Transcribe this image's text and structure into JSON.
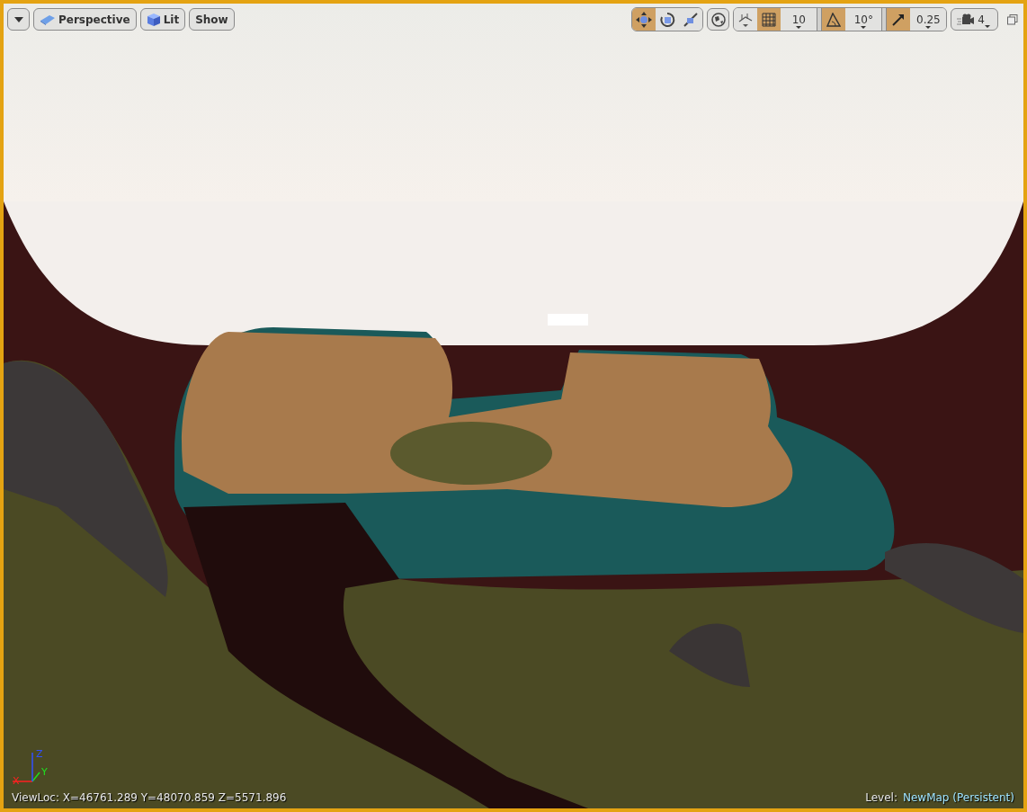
{
  "viewport": {
    "active": true
  },
  "left_buttons": [
    {
      "kind": "dropdown"
    },
    {
      "kind": "perspective",
      "label": "Perspective"
    },
    {
      "kind": "lit",
      "label": "Lit"
    },
    {
      "kind": "show",
      "label": "Show"
    }
  ],
  "transform_tools": [
    {
      "kind": "translate",
      "selected": true
    },
    {
      "kind": "rotate",
      "selected": false
    },
    {
      "kind": "scale",
      "selected": false
    }
  ],
  "coordinate_space": {
    "kind": "world"
  },
  "surface_snapping": {
    "on": false
  },
  "snaps": [
    {
      "kind": "grid",
      "on": true,
      "value": "10"
    },
    {
      "kind": "rotation",
      "on": true,
      "value": "10°"
    },
    {
      "kind": "scale",
      "on": true,
      "value": "0.25"
    }
  ],
  "camera_speed": {
    "value": "4"
  },
  "axis_labels": [
    "X",
    "Y",
    "Z"
  ],
  "view_location": "ViewLoc: X=46761.289 Y=48070.859 Z=5571.896",
  "level": {
    "label": "Level:",
    "name": "NewMap (Persistent)"
  }
}
